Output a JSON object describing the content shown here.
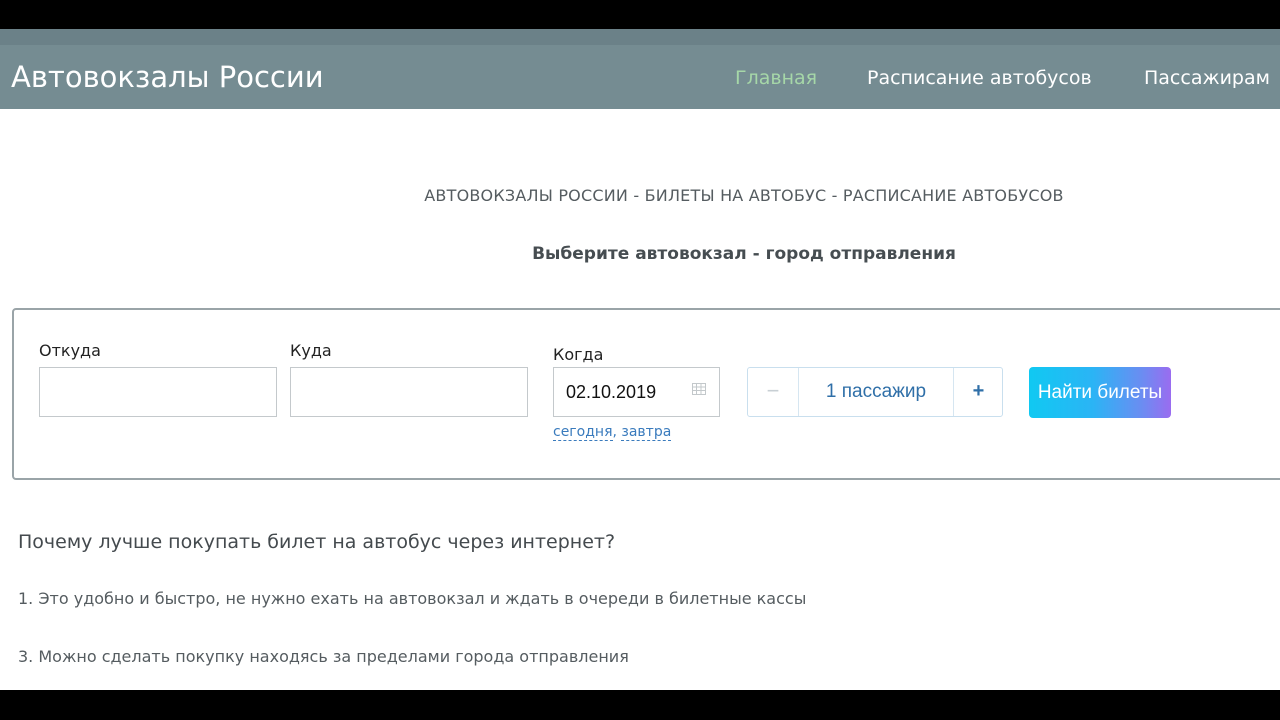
{
  "navbar": {
    "brand": "Автовокзалы России",
    "items": [
      {
        "label": "Главная",
        "active": true
      },
      {
        "label": "Расписание автобусов",
        "active": false
      },
      {
        "label": "Пассажирам",
        "active": false
      }
    ]
  },
  "heading": "АВТОВОКЗАЛЫ РОССИИ - БИЛЕТЫ НА АВТОБУС - РАСПИСАНИЕ АВТОБУСОВ",
  "subheading": "Выберите автовокзал - город отправления",
  "search": {
    "from_label": "Откуда",
    "from_value": "",
    "to_label": "Куда",
    "to_value": "",
    "when_label": "Когда",
    "date_value": "02.10.2019",
    "today_link": "сегодня",
    "separator": ",",
    "tomorrow_link": "завтра",
    "minus": "−",
    "passengers": "1 пассажир",
    "plus": "+",
    "submit": "Найти билеты"
  },
  "why": {
    "title": "Почему лучше покупать билет на автобус через интернет?",
    "items": [
      "1. Это удобно и быстро, не нужно ехать на автовокзал и ждать в очереди в билетные кассы",
      "3. Можно сделать покупку находясь за пределами города отправления"
    ]
  },
  "colors": {
    "navbar": "#758c92",
    "active_nav": "#a6d7a8",
    "link": "#3a7bbd",
    "button_gradient_start": "#10c9f2",
    "button_gradient_end": "#9a6cf0"
  },
  "icons": {
    "calendar": "calendar-icon"
  }
}
